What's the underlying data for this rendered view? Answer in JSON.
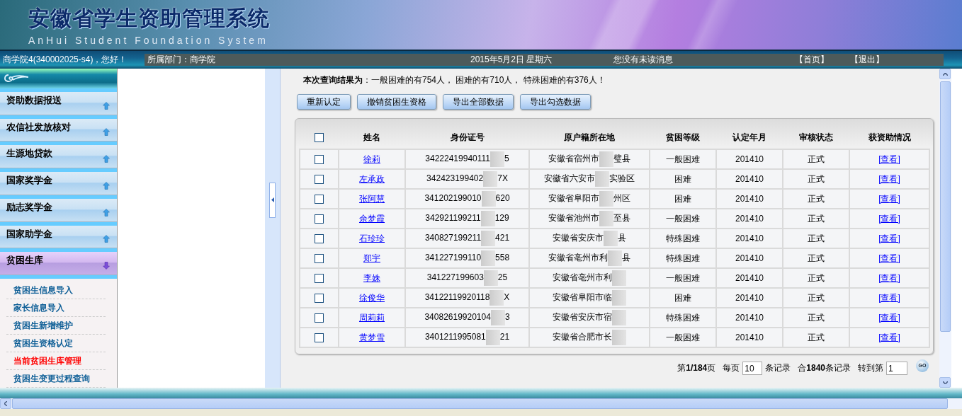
{
  "header": {
    "title": "安徽省学生资助管理系统",
    "subtitle": "AnHui Student Foundation System"
  },
  "navbar": {
    "greeting": "商学院4(340002025-s4)，您好！",
    "department": "所属部门：商学院",
    "date": "2015年5月2日 星期六",
    "messages": "您没有未读消息",
    "links": [
      "【首页】",
      "【退出】"
    ]
  },
  "sidebar": {
    "groups": [
      {
        "label": "资助数据报送",
        "selected": false
      },
      {
        "label": "农信社发放核对",
        "selected": false
      },
      {
        "label": "生源地贷款",
        "selected": false
      },
      {
        "label": "国家奖学金",
        "selected": false
      },
      {
        "label": "励志奖学金",
        "selected": false
      },
      {
        "label": "国家助学金",
        "selected": false
      },
      {
        "label": "贫困生库",
        "selected": true,
        "children": [
          {
            "label": "贫困生信息导入",
            "selected": false
          },
          {
            "label": "家长信息导入",
            "selected": false
          },
          {
            "label": "贫困生新增维护",
            "selected": false
          },
          {
            "label": "贫困生资格认定",
            "selected": false
          },
          {
            "label": "当前贫困生库管理",
            "selected": true
          },
          {
            "label": "贫困生变更过程查询",
            "selected": false
          }
        ]
      }
    ]
  },
  "summary": "**本次查询结果为**：一般困难的有754人， 困难的有710人， 特殊困难的有376人！",
  "buttons": [
    "重新认定",
    "撤销贫困生资格",
    "导出全部数据",
    "导出勾选数据"
  ],
  "table": {
    "select_all_checked": false,
    "columns": [
      "姓名",
      "身份证号",
      "原户籍所在地",
      "贫困等级",
      "认定年月",
      "审核状态",
      "获资助情况"
    ],
    "rows": [
      {
        "checked": false,
        "name": "徐莉",
        "id_start": "34222419940111",
        "id_end": "5",
        "address_start": "安徽省宿州市",
        "address_end": "璧县",
        "level": "一般困难",
        "date": "201410",
        "status": "正式",
        "action": "[查看]"
      },
      {
        "checked": false,
        "name": "左承政",
        "id_start": "342423199402",
        "id_end": "7X",
        "address_start": "安徽省六安市",
        "address_end": "实验区",
        "level": "困难",
        "date": "201410",
        "status": "正式",
        "action": "[查看]"
      },
      {
        "checked": false,
        "name": "张阿慧",
        "id_start": "341202199010",
        "id_end": "620",
        "address_start": "安徽省阜阳市",
        "address_end": "州区",
        "level": "困难",
        "date": "201410",
        "status": "正式",
        "action": "[查看]"
      },
      {
        "checked": false,
        "name": "余梦霞",
        "id_start": "342921199211",
        "id_end": "129",
        "address_start": "安徽省池州市",
        "address_end": "至县",
        "level": "一般困难",
        "date": "201410",
        "status": "正式",
        "action": "[查看]"
      },
      {
        "checked": false,
        "name": "石珍珍",
        "id_start": "340827199211",
        "id_end": "421",
        "address_start": "安徽省安庆市",
        "address_end": "县",
        "level": "特殊困难",
        "date": "201410",
        "status": "正式",
        "action": "[查看]"
      },
      {
        "checked": false,
        "name": "郑宇",
        "id_start": "341227199110",
        "id_end": "558",
        "address_start": "安徽省亳州市利",
        "address_end": "县",
        "level": "特殊困难",
        "date": "201410",
        "status": "正式",
        "action": "[查看]"
      },
      {
        "checked": false,
        "name": "李姝",
        "id_start": "341227199603",
        "id_end": "25",
        "address_start": "安徽省亳州市利",
        "level": "一般困难",
        "date": "201410",
        "status": "正式",
        "action": "[查看]"
      },
      {
        "checked": false,
        "name": "徐俊华",
        "id_start": "34122119920118",
        "id_end": "X",
        "address_start": "安徽省阜阳市临",
        "level": "困难",
        "date": "201410",
        "status": "正式",
        "action": "[查看]"
      },
      {
        "checked": false,
        "name": "周莉莉",
        "id_start": "34082619920104",
        "id_end": "3",
        "address_start": "安徽省安庆市宿",
        "level": "特殊困难",
        "date": "201410",
        "status": "正式",
        "action": "[查看]"
      },
      {
        "checked": false,
        "name": "黄梦雪",
        "id_start": "3401211995081",
        "id_end": "21",
        "address_start": "安徽省合肥市长",
        "level": "一般困难",
        "date": "201410",
        "status": "正式",
        "action": "[查看]"
      }
    ]
  },
  "pagination": {
    "page": "第**1/184**页",
    "per_page_label": "每页",
    "per_page": "10",
    "records_label": "条记录",
    "total": "合**1840**条记录",
    "goto_label": "转到第",
    "goto_page": "1",
    "go": "GO"
  }
}
